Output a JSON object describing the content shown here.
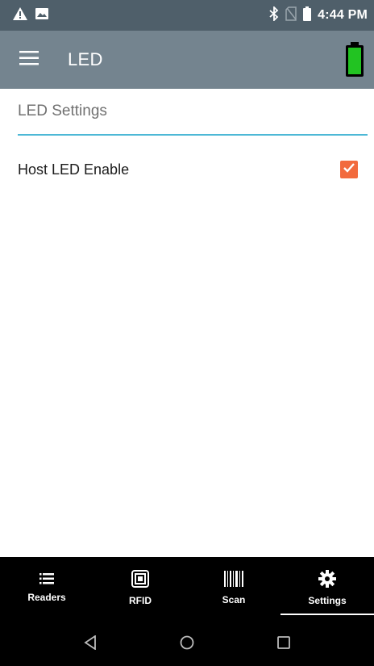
{
  "status_bar": {
    "time": "4:44 PM",
    "icons": [
      "warning-icon",
      "image-icon",
      "bluetooth-icon",
      "no-sim-icon",
      "battery-icon"
    ]
  },
  "app_bar": {
    "title": "LED",
    "menu_icon": "hamburger-menu-icon",
    "reader_battery_icon": "battery-full-icon"
  },
  "content": {
    "section_title": "LED Settings",
    "settings": [
      {
        "label": "Host LED Enable",
        "checked": true
      }
    ]
  },
  "bottom_nav": {
    "items": [
      {
        "label": "Readers",
        "icon": "list-icon",
        "active": false
      },
      {
        "label": "RFID",
        "icon": "rfid-icon",
        "active": false
      },
      {
        "label": "Scan",
        "icon": "barcode-icon",
        "active": false
      },
      {
        "label": "Settings",
        "icon": "gear-icon",
        "active": true
      }
    ]
  },
  "colors": {
    "status_bar": "#4f5f6a",
    "app_bar": "#74848f",
    "accent_line": "#4db8d6",
    "checkbox": "#f26a3d",
    "battery_fill": "#22c322",
    "nav_background": "#000000"
  }
}
